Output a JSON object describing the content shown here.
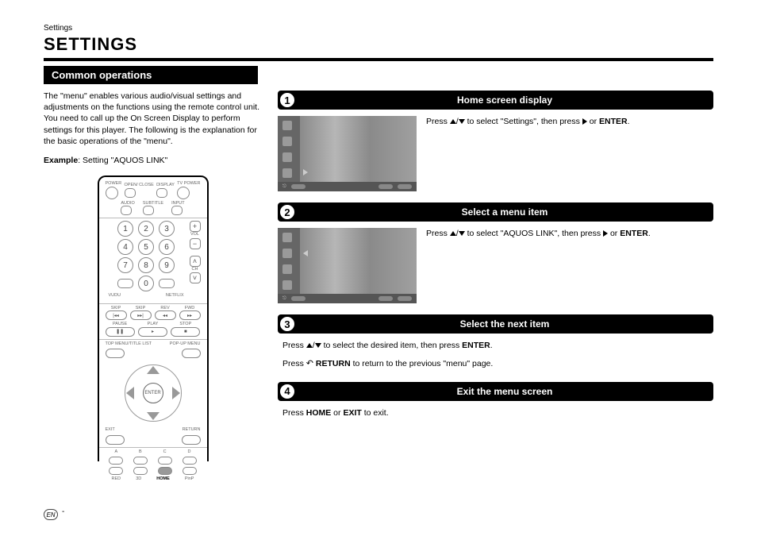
{
  "breadcrumb": "Settings",
  "page_title": "SETTINGS",
  "section_heading": "Common operations",
  "intro": "The \"menu\" enables various audio/visual settings and adjustments on the functions using the remote control unit. You need to call up the On Screen Display to perform settings for this player. The following is the explanation for the basic operations of the \"menu\".",
  "example_label": "Example",
  "example_value": ": Setting \"AQUOS LINK\"",
  "steps": [
    {
      "num": "1",
      "title": "Home screen display",
      "text_pre": "Press ",
      "text_mid": " to select \"Settings\", then press ",
      "text_post": " or ",
      "enter": "ENTER",
      "tail": "."
    },
    {
      "num": "2",
      "title": "Select a menu item",
      "text_pre": "Press ",
      "text_mid": " to select \"AQUOS LINK\", then press ",
      "text_post": " or ",
      "enter": "ENTER",
      "tail": "."
    },
    {
      "num": "3",
      "title": "Select the next item",
      "line1_pre": "Press ",
      "line1_mid": " to select the desired item, then press ",
      "line1_enter": "ENTER",
      "line1_tail": ".",
      "line2_pre": "Press ",
      "line2_bold": " RETURN ",
      "line2_tail": " to return to the previous \"menu\" page."
    },
    {
      "num": "4",
      "title": "Exit the menu screen",
      "line_pre": "Press ",
      "home": "HOME",
      "line_mid": " or ",
      "exit": "EXIT",
      "line_tail": " to exit."
    }
  ],
  "remote": {
    "row1": [
      "POWER",
      "OPEN/\nCLOSE",
      "DISPLAY",
      "TV\nPOWER"
    ],
    "row2": [
      "AUDIO",
      "SUBTITLE",
      "INPUT"
    ],
    "nums": [
      "1",
      "2",
      "3",
      "4",
      "5",
      "6",
      "7",
      "8",
      "9",
      "0"
    ],
    "vudu": "VUDU",
    "netflix": "NETFLIX",
    "vol": "VOL",
    "ch": "CH",
    "transport_top": [
      "SKIP",
      "SKIP",
      "REV",
      "FWD"
    ],
    "transport_bot": [
      "PAUSE",
      "PLAY",
      "STOP"
    ],
    "topmenu": "TOP MENU/TITLE LIST",
    "popup": "POP-UP MENU",
    "enter": "ENTER",
    "exitlbl": "EXIT",
    "returnlbl": "RETURN",
    "abcd": [
      "A",
      "B",
      "C",
      "D"
    ],
    "bottom": [
      "RED",
      "3D",
      "HOME",
      "PinP"
    ]
  },
  "footer_lang": "EN"
}
